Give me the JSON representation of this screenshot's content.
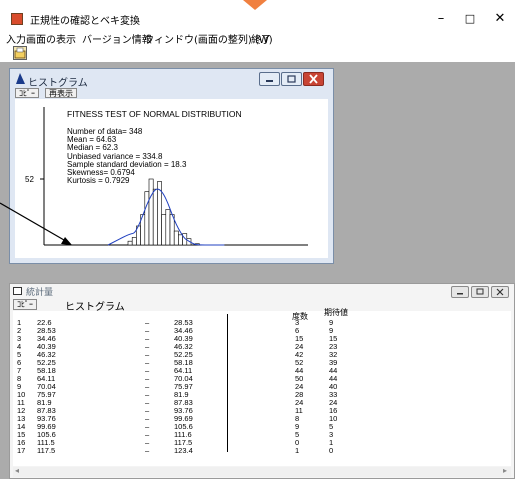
{
  "app": {
    "title": "正規性の確認とベキ変換",
    "controls": {
      "minimize": "–",
      "maximize": "□",
      "close": "✕"
    }
  },
  "menu": {
    "items": [
      "入力画面の表示",
      "バージョン情報",
      "ウィンドウ(画面の整列) (W)",
      "終了"
    ]
  },
  "toolbar": {
    "icon": "open-icon"
  },
  "histogram_window": {
    "title": "ヒストグラム",
    "tabs": [
      "ｺﾋﾟｰ",
      "再表示"
    ],
    "heading": "FITNESS TEST OF NORMAL DISTRIBUTION",
    "stats_lines": [
      "Number of data= 348",
      "Mean  = 64.63",
      "Median = 62.3",
      "Unbiased variance = 334.8",
      "Sample standard deviation = 18.3",
      "Skewness= 0.6794",
      "Kurtosis  = 0.7929"
    ],
    "y_max_label": "52"
  },
  "chart_data": {
    "type": "bar",
    "title": "",
    "xlabel": "",
    "ylabel": "",
    "categories": [
      "22.6",
      "28.53",
      "34.46",
      "40.39",
      "46.32",
      "52.25",
      "58.18",
      "64.11",
      "70.04",
      "75.97",
      "81.9",
      "87.83",
      "93.76",
      "99.69",
      "105.6",
      "111.5",
      "117.5"
    ],
    "series": [
      {
        "values": [
          3,
          6,
          15,
          24,
          42,
          52,
          44,
          50,
          24,
          28,
          24,
          11,
          8,
          9,
          5,
          0,
          1
        ]
      },
      {
        "values": [
          9,
          9,
          15,
          23,
          32,
          39,
          44,
          44,
          40,
          33,
          24,
          16,
          10,
          5,
          3,
          1,
          0
        ]
      }
    ],
    "ylim": [
      0,
      52
    ]
  },
  "stats_window": {
    "title": "統計量",
    "tab": "ｺﾋﾟｰ",
    "heading": "ヒストグラム",
    "col_headers": [
      "度数",
      "期待値"
    ],
    "rows": [
      [
        "1",
        "22.6",
        "–",
        "28.53",
        "3",
        "9"
      ],
      [
        "2",
        "28.53",
        "–",
        "34.46",
        "6",
        "9"
      ],
      [
        "3",
        "34.46",
        "–",
        "40.39",
        "15",
        "15"
      ],
      [
        "4",
        "40.39",
        "–",
        "46.32",
        "24",
        "23"
      ],
      [
        "5",
        "46.32",
        "–",
        "52.25",
        "42",
        "32"
      ],
      [
        "6",
        "52.25",
        "–",
        "58.18",
        "52",
        "39"
      ],
      [
        "7",
        "58.18",
        "–",
        "64.11",
        "44",
        "44"
      ],
      [
        "8",
        "64.11",
        "–",
        "70.04",
        "50",
        "44"
      ],
      [
        "9",
        "70.04",
        "–",
        "75.97",
        "24",
        "40"
      ],
      [
        "10",
        "75.97",
        "–",
        "81.9",
        "28",
        "33"
      ],
      [
        "11",
        "81.9",
        "–",
        "87.83",
        "24",
        "24"
      ],
      [
        "12",
        "87.83",
        "–",
        "93.76",
        "11",
        "16"
      ],
      [
        "13",
        "93.76",
        "–",
        "99.69",
        "8",
        "10"
      ],
      [
        "14",
        "99.69",
        "–",
        "105.6",
        "9",
        "5"
      ],
      [
        "15",
        "105.6",
        "–",
        "111.6",
        "5",
        "3"
      ],
      [
        "16",
        "111.5",
        "–",
        "117.5",
        "0",
        "1"
      ],
      [
        "17",
        "117.5",
        "–",
        "123.4",
        "1",
        "0"
      ]
    ],
    "scroll_left": "◂",
    "scroll_right": "▸"
  }
}
